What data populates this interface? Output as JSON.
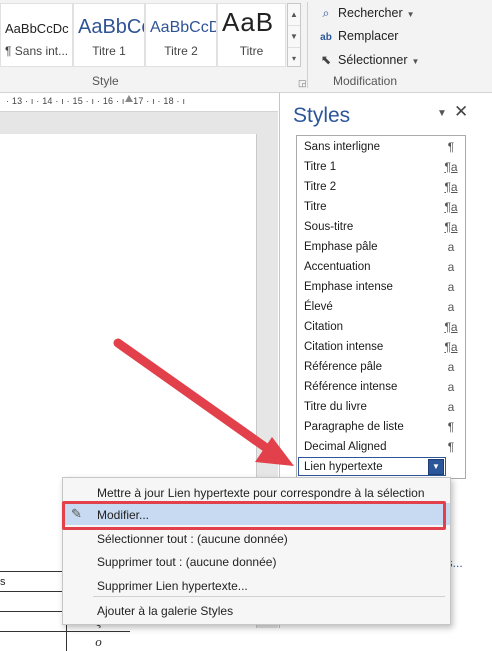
{
  "ribbon": {
    "style_gallery": [
      {
        "sample": "AaBbCcDc",
        "name": "¶ Sans int..."
      },
      {
        "sample": "AaBbCc",
        "name": "Titre 1"
      },
      {
        "sample": "AaBbCcD",
        "name": "Titre 2"
      },
      {
        "sample": "AaB",
        "name": "Titre"
      }
    ],
    "style_group_label": "Style",
    "editing": {
      "find": "Rechercher",
      "replace": "Remplacer",
      "select": "Sélectionner",
      "group_label": "Modification"
    }
  },
  "ruler": {
    "text": "· 13 · ı · 14 · ı · 15 · ı · 16 · ı · 17 · ı · 18 · ı"
  },
  "document": {
    "table_rows": [
      {
        "c1": "s",
        "c2": ""
      },
      {
        "c1": "",
        "c2": "ν"
      },
      {
        "c1": "",
        "c2": "ξ"
      },
      {
        "c1": "",
        "c2": "ο"
      }
    ]
  },
  "styles_pane": {
    "title": "Styles",
    "items": [
      {
        "label": "Sans interligne",
        "mark": "¶"
      },
      {
        "label": "Titre 1",
        "mark": "¶a"
      },
      {
        "label": "Titre 2",
        "mark": "¶a"
      },
      {
        "label": "Titre",
        "mark": "¶a"
      },
      {
        "label": "Sous-titre",
        "mark": "¶a"
      },
      {
        "label": "Emphase pâle",
        "mark": "a"
      },
      {
        "label": "Accentuation",
        "mark": "a"
      },
      {
        "label": "Emphase intense",
        "mark": "a"
      },
      {
        "label": "Élevé",
        "mark": "a"
      },
      {
        "label": "Citation",
        "mark": "¶a"
      },
      {
        "label": "Citation intense",
        "mark": "¶a"
      },
      {
        "label": "Référence pâle",
        "mark": "a"
      },
      {
        "label": "Référence intense",
        "mark": "a"
      },
      {
        "label": "Titre du livre",
        "mark": "a"
      },
      {
        "label": "Paragraphe de liste",
        "mark": "¶"
      },
      {
        "label": "Decimal Aligned",
        "mark": "¶"
      },
      {
        "label": "Lien hypertexte",
        "mark": "▼"
      }
    ],
    "bottom_link": "ns..."
  },
  "context_menu": {
    "update": "Mettre à jour Lien hypertexte pour correspondre à la sélection",
    "modify": "Modifier...",
    "select_all": "Sélectionner tout : (aucune donnée)",
    "delete_all": "Supprimer tout : (aucune donnée)",
    "delete": "Supprimer Lien hypertexte...",
    "add_gallery": "Ajouter à la galerie Styles"
  },
  "colors": {
    "accent": "#2b579a",
    "arrow": "#e2404a",
    "highlight": "#c7daf1"
  }
}
